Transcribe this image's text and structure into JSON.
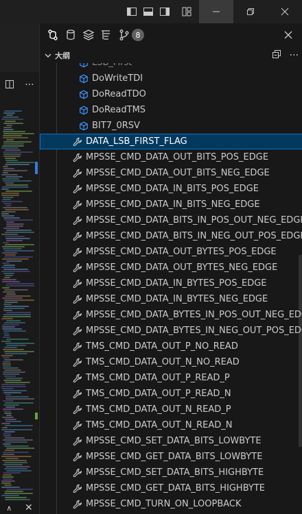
{
  "section": {
    "title": "大纲"
  },
  "header": {
    "badge_count": "8"
  },
  "outline": {
    "partial_item": "LSB_First",
    "method_items": [
      "DoWriteTDI",
      "DoReadTDO",
      "DoReadTMS",
      "BIT7_0RSV"
    ],
    "selected_item": "DATA_LSB_FIRST_FLAG",
    "constant_items": [
      "MPSSE_CMD_DATA_OUT_BITS_POS_EDGE",
      "MPSSE_CMD_DATA_OUT_BITS_NEG_EDGE",
      "MPSSE_CMD_DATA_IN_BITS_POS_EDGE",
      "MPSSE_CMD_DATA_IN_BITS_NEG_EDGE",
      "MPSSE_CMD_DATA_BITS_IN_POS_OUT_NEG_EDGE",
      "MPSSE_CMD_DATA_BITS_IN_NEG_OUT_POS_EDGE",
      "MPSSE_CMD_DATA_OUT_BYTES_POS_EDGE",
      "MPSSE_CMD_DATA_OUT_BYTES_NEG_EDGE",
      "MPSSE_CMD_DATA_IN_BYTES_POS_EDGE",
      "MPSSE_CMD_DATA_IN_BYTES_NEG_EDGE",
      "MPSSE_CMD_DATA_BYTES_IN_POS_OUT_NEG_EDGE",
      "MPSSE_CMD_DATA_BYTES_IN_NEG_OUT_POS_EDGE",
      "TMS_CMD_DATA_OUT_P_NO_READ",
      "TMS_CMD_DATA_OUT_N_NO_READ",
      "TMS_CMD_DATA_OUT_P_READ_P",
      "TMS_CMD_DATA_OUT_P_READ_N",
      "TMS_CMD_DATA_OUT_N_READ_P",
      "TMS_CMD_DATA_OUT_N_READ_N",
      "MPSSE_CMD_SET_DATA_BITS_LOWBYTE",
      "MPSSE_CMD_GET_DATA_BITS_LOWBYTE",
      "MPSSE_CMD_SET_DATA_BITS_HIGHBYTE",
      "MPSSE_CMD_GET_DATA_BITS_HIGHBYTE",
      "MPSSE_CMD_TURN_ON_LOOPBACK"
    ]
  },
  "colors": {
    "method_icon": "#3794ff",
    "constant_icon": "#cccccc",
    "selection_bg": "#04395e",
    "selection_border": "#0078d4"
  },
  "icons": {
    "titlebar": [
      "toggle-primary-sidebar-icon",
      "toggle-panel-icon",
      "toggle-secondary-sidebar-icon",
      "customize-layout-icon"
    ],
    "panel": [
      "source-control-icon",
      "database-icon",
      "extensions-icon",
      "test-tree-icon",
      "git-branch-icon"
    ],
    "method": "method-cube-icon",
    "constant": "wrench-icon"
  }
}
